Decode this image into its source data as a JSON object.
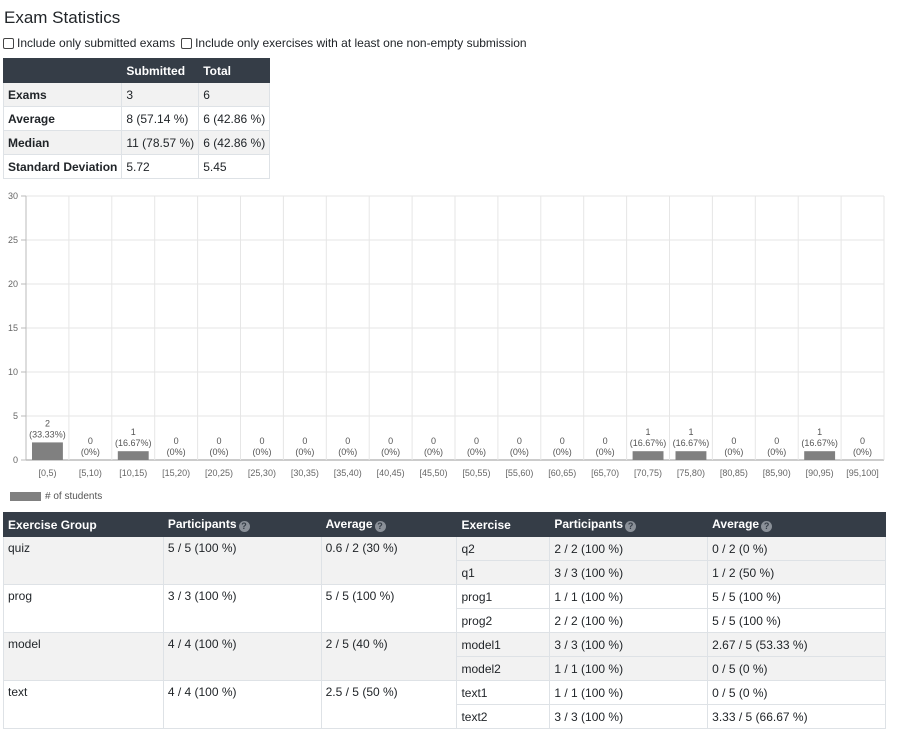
{
  "page": {
    "title": "Exam Statistics"
  },
  "filters": [
    {
      "label": "Include only submitted exams",
      "checked": false
    },
    {
      "label": "Include only exercises with at least one non-empty submission",
      "checked": false
    }
  ],
  "stats": {
    "headers": [
      "",
      "Submitted",
      "Total"
    ],
    "rows": [
      {
        "label": "Exams",
        "submitted": "3",
        "total": "6"
      },
      {
        "label": "Average",
        "submitted": "8 (57.14 %)",
        "total": "6 (42.86 %)"
      },
      {
        "label": "Median",
        "submitted": "11 (78.57 %)",
        "total": "6 (42.86 %)"
      },
      {
        "label": "Standard Deviation",
        "submitted": "5.72",
        "total": "5.45"
      }
    ]
  },
  "chart_data": {
    "type": "bar",
    "categories": [
      "[0,5)",
      "[5,10)",
      "[10,15)",
      "[15,20)",
      "[20,25)",
      "[25,30)",
      "[30,35)",
      "[35,40)",
      "[40,45)",
      "[45,50)",
      "[50,55)",
      "[55,60)",
      "[60,65)",
      "[65,70)",
      "[70,75)",
      "[75,80)",
      "[80,85)",
      "[85,90)",
      "[90,95)",
      "[95,100]"
    ],
    "series": [
      {
        "name": "# of students",
        "values": [
          2,
          0,
          1,
          0,
          0,
          0,
          0,
          0,
          0,
          0,
          0,
          0,
          0,
          0,
          1,
          1,
          0,
          0,
          1,
          0
        ],
        "labels": [
          "(33.33%)",
          "(0%)",
          "(16.67%)",
          "(0%)",
          "(0%)",
          "(0%)",
          "(0%)",
          "(0%)",
          "(0%)",
          "(0%)",
          "(0%)",
          "(0%)",
          "(0%)",
          "(0%)",
          "(16.67%)",
          "(16.67%)",
          "(0%)",
          "(0%)",
          "(16.67%)",
          "(0%)"
        ]
      }
    ],
    "ylim": [
      0,
      30
    ],
    "yticks": [
      0,
      5,
      10,
      15,
      20,
      25,
      30
    ],
    "grid": true,
    "legend": "bottom-left",
    "bar_color": "#808080",
    "xlabel": "",
    "ylabel": ""
  },
  "exercise_table": {
    "headers": {
      "group": "Exercise Group",
      "group_participants": "Participants",
      "group_average": "Average",
      "exercise": "Exercise",
      "participants": "Participants",
      "average": "Average"
    },
    "groups": [
      {
        "name": "quiz",
        "participants": "5 / 5 (100 %)",
        "average": "0.6 / 2 (30 %)",
        "exercises": [
          {
            "name": "q2",
            "participants": "2 / 2 (100 %)",
            "average": "0 / 2 (0 %)"
          },
          {
            "name": "q1",
            "participants": "3 / 3 (100 %)",
            "average": "1 / 2 (50 %)"
          }
        ]
      },
      {
        "name": "prog",
        "participants": "3 / 3 (100 %)",
        "average": "5 / 5 (100 %)",
        "exercises": [
          {
            "name": "prog1",
            "participants": "1 / 1 (100 %)",
            "average": "5 / 5 (100 %)"
          },
          {
            "name": "prog2",
            "participants": "2 / 2 (100 %)",
            "average": "5 / 5 (100 %)"
          }
        ]
      },
      {
        "name": "model",
        "participants": "4 / 4 (100 %)",
        "average": "2 / 5 (40 %)",
        "exercises": [
          {
            "name": "model1",
            "participants": "3 / 3 (100 %)",
            "average": "2.67 / 5 (53.33 %)"
          },
          {
            "name": "model2",
            "participants": "1 / 1 (100 %)",
            "average": "0 / 5 (0 %)"
          }
        ]
      },
      {
        "name": "text",
        "participants": "4 / 4 (100 %)",
        "average": "2.5 / 5 (50 %)",
        "exercises": [
          {
            "name": "text1",
            "participants": "1 / 1 (100 %)",
            "average": "0 / 5 (0 %)"
          },
          {
            "name": "text2",
            "participants": "3 / 3 (100 %)",
            "average": "3.33 / 5 (66.67 %)"
          }
        ]
      }
    ]
  },
  "icons": {
    "help": "question-circle-icon"
  }
}
